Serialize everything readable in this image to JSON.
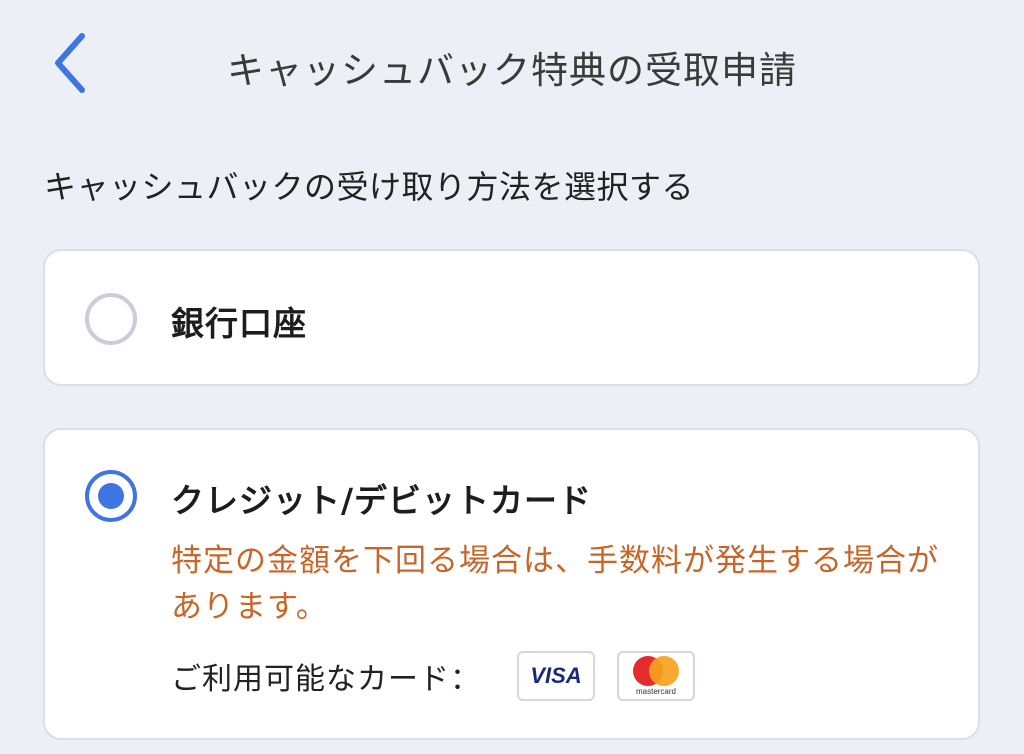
{
  "header": {
    "title": "キャッシュバック特典の受取申請",
    "back_icon": "chevron-left-icon",
    "accent_color": "#3f75e3"
  },
  "section": {
    "title": "キャッシュバックの受け取り方法を選択する"
  },
  "options": [
    {
      "label": "銀行口座",
      "selected": false
    },
    {
      "label": "クレジット/デビットカード",
      "selected": true,
      "warning": "特定の金額を下回る場合は、手数料が発生する場合があります。",
      "warning_color": "#c8662a",
      "available_cards_label": "ご利用可能なカード：",
      "card_brands": [
        "VISA",
        "mastercard"
      ]
    }
  ]
}
